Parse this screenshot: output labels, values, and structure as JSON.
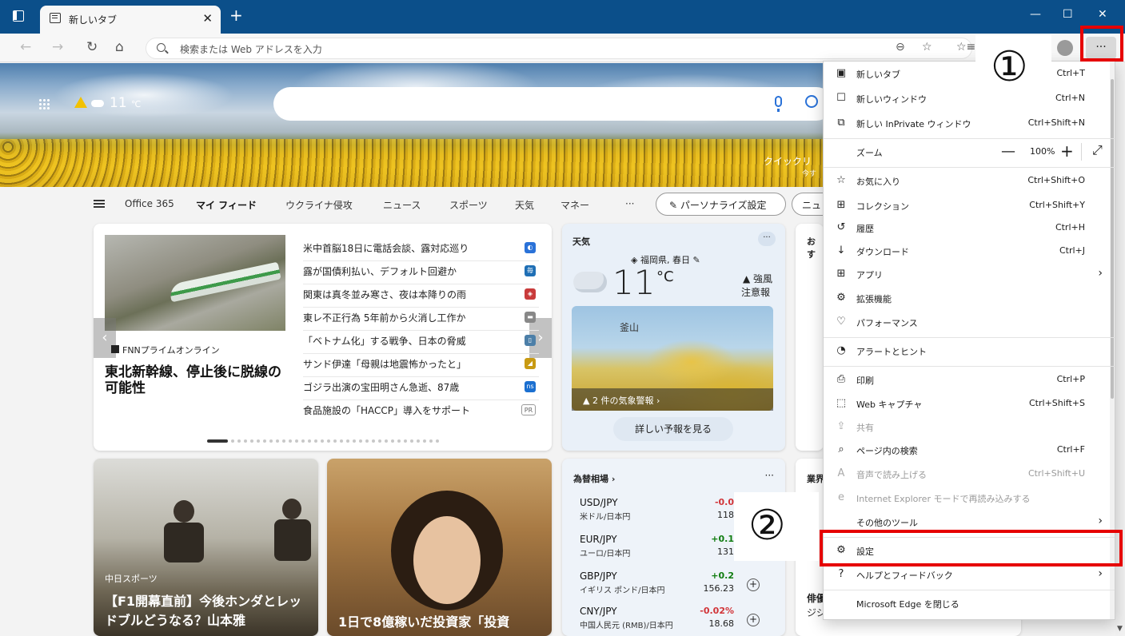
{
  "tab": {
    "title": "新しいタブ",
    "close": "✕",
    "new": "+"
  },
  "window": {
    "minimize": "—",
    "maximize": "☐",
    "close": "✕"
  },
  "toolbar": {
    "back": "←",
    "forward": "→",
    "refresh": "↻",
    "home": "⌂",
    "search_placeholder": "検索または Web アドレスを入力",
    "zoom_glyph": "⊖",
    "fav_add": "☆",
    "favorites": "☆≡",
    "more": "···"
  },
  "hero": {
    "temperature": "11",
    "temp_unit": "℃",
    "quicklinks": "クイックリ",
    "quicklinks_sub": "今す"
  },
  "feed_nav": {
    "tabs": [
      "Office 365",
      "マイ フィード",
      "ウクライナ侵攻",
      "ニュース",
      "スポーツ",
      "天気",
      "マネー",
      "···"
    ],
    "personalize": "✎ パーソナライズ設定",
    "news_partial": "ニュ"
  },
  "main_card": {
    "source": "FNNプライムオンライン",
    "headline": "東北新幹線、停止後に脱線の可能性",
    "news": [
      {
        "title": "米中首脳18日に電話会談、露対応巡り",
        "badge": "◐",
        "color": "#2a72d8"
      },
      {
        "title": "露が国債利払い、デフォルト回避か",
        "badge": "毎",
        "color": "#1f6fb5"
      },
      {
        "title": "関東は真冬並み寒さ、夜は本降りの雨",
        "badge": "◈",
        "color": "#c93b3b"
      },
      {
        "title": "東レ不正行為 5年前から火消し工作か",
        "badge": "▬",
        "color": "#888888"
      },
      {
        "title": "「ベトナム化」する戦争、日本の脅威",
        "badge": "▯",
        "color": "#4c7fa8"
      },
      {
        "title": "サンド伊達「母親は地震怖かったと」",
        "badge": "◢",
        "color": "#c89a12"
      },
      {
        "title": "ゴジラ出演の宝田明さん急逝、87歳",
        "badge": "ns",
        "color": "#1b6fd0"
      },
      {
        "title": "食品施設の「HACCP」導入をサポート",
        "badge": "PR",
        "color": "#ffffff"
      }
    ],
    "arrow_left": "‹",
    "arrow_right": "›"
  },
  "weather_card": {
    "title": "天気",
    "more": "···",
    "location": "◈ 福岡県, 春日 ✎",
    "temp": "11",
    "unit": "°C",
    "alert1": "▲ 強風",
    "alert2": "注意報",
    "map_city": "釜山",
    "map_alert": "▲ 2 件の気象警報 ›",
    "forecast": "詳しい予報を見る"
  },
  "side_card": {
    "title": "おす"
  },
  "photo_card1": {
    "source": "中日スポーツ",
    "headline": "【F1開幕直前】今後ホンダとレッドブルどうなる？山本雅"
  },
  "photo_card2": {
    "headline": "1日で8億稼いだ投資家「投資"
  },
  "fx_card": {
    "title": "為替相場 ›",
    "more": "···",
    "rows": [
      {
        "pair": "USD/JPY",
        "name": "米ドル/日本円",
        "change": "-0.0",
        "value": "118",
        "color": "#d13438"
      },
      {
        "pair": "EUR/JPY",
        "name": "ユーロ/日本円",
        "change": "+0.1",
        "value": "131",
        "color": "#107c10"
      },
      {
        "pair": "GBP/JPY",
        "name": "イギリス ポンド/日本円",
        "change": "+0.2",
        "value": "156.23",
        "color": "#107c10"
      },
      {
        "pair": "CNY/JPY",
        "name": "中国人民元 (RMB)/日本円",
        "change": "-0.02%",
        "value": "18.68",
        "color": "#d13438"
      }
    ],
    "add": "+"
  },
  "side_card2": {
    "title": "業界",
    "text1": "俳優",
    "text2": "ジジ"
  },
  "menu": {
    "items": [
      {
        "icon": "▣",
        "label": "新しいタブ",
        "key": "Ctrl+T"
      },
      {
        "icon": "☐",
        "label": "新しいウィンドウ",
        "key": "Ctrl+N"
      },
      {
        "icon": "⧉",
        "label": "新しい InPrivate ウィンドウ",
        "key": "Ctrl+Shift+N"
      },
      {
        "icon": "",
        "label": "ズーム",
        "key": ""
      },
      {
        "icon": "☆",
        "label": "お気に入り",
        "key": "Ctrl+Shift+O"
      },
      {
        "icon": "⊞",
        "label": "コレクション",
        "key": "Ctrl+Shift+Y"
      },
      {
        "icon": "↺",
        "label": "履歴",
        "key": "Ctrl+H"
      },
      {
        "icon": "↓",
        "label": "ダウンロード",
        "key": "Ctrl+J"
      },
      {
        "icon": "⊞",
        "label": "アプリ",
        "key": ""
      },
      {
        "icon": "⚙",
        "label": "拡張機能",
        "key": ""
      },
      {
        "icon": "♡",
        "label": "パフォーマンス",
        "key": ""
      },
      {
        "icon": "◔",
        "label": "アラートとヒント",
        "key": ""
      },
      {
        "icon": "⎙",
        "label": "印刷",
        "key": "Ctrl+P"
      },
      {
        "icon": "⬚",
        "label": "Web キャプチャ",
        "key": "Ctrl+Shift+S"
      },
      {
        "icon": "⇪",
        "label": "共有",
        "key": ""
      },
      {
        "icon": "⌕",
        "label": "ページ内の検索",
        "key": "Ctrl+F"
      },
      {
        "icon": "A",
        "label": "音声で読み上げる",
        "key": "Ctrl+Shift+U"
      },
      {
        "icon": "e",
        "label": "Internet Explorer モードで再読み込みする",
        "key": ""
      },
      {
        "icon": "",
        "label": "その他のツール",
        "key": ""
      },
      {
        "icon": "⚙",
        "label": "設定",
        "key": ""
      },
      {
        "icon": "?",
        "label": "ヘルプとフィードバック",
        "key": ""
      },
      {
        "icon": "",
        "label": "Microsoft Edge を閉じる",
        "key": ""
      }
    ],
    "zoom_minus": "—",
    "zoom_value": "100%",
    "zoom_plus": "+",
    "zoom_full": "⤢",
    "chevron": "›"
  },
  "annotations": {
    "step1": "①",
    "step2": "②"
  },
  "colors": {
    "titlebar": "#0b4f8a",
    "highlight": "#e60000"
  }
}
